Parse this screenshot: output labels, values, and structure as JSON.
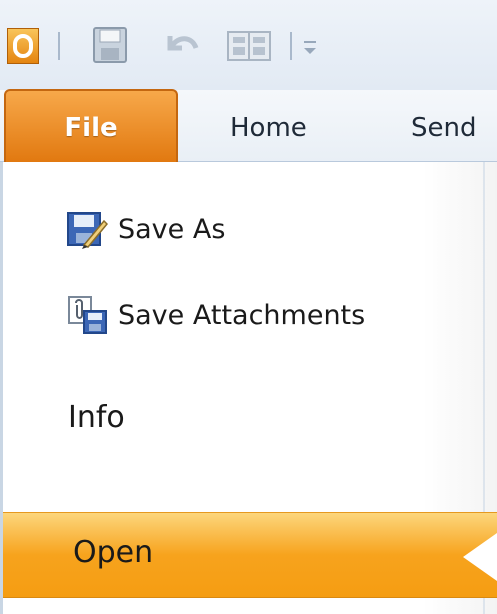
{
  "quick_access_toolbar": {
    "icons": [
      "outlook-app-icon",
      "save-icon",
      "undo-icon",
      "address-book-icon",
      "customize-icon"
    ]
  },
  "ribbon": {
    "tabs": {
      "file": "File",
      "home": "Home",
      "send": "Send"
    }
  },
  "backstage": {
    "save_as": "Save As",
    "save_attachments": "Save Attachments",
    "info": "Info",
    "open": "Open"
  },
  "colors": {
    "file_tab": "#e97f16",
    "selected_item": "#f7a31d",
    "ribbon_bg": "#eef3f9"
  }
}
